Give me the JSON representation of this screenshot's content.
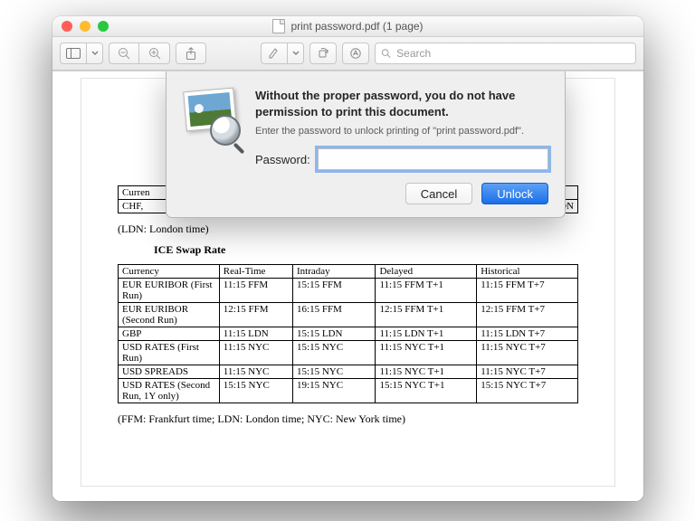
{
  "titlebar": {
    "title": "print password.pdf (1 page)"
  },
  "toolbar": {
    "search_placeholder": "Search"
  },
  "sheet": {
    "heading": "Without the proper password, you do not have permission to print this document.",
    "subtext": "Enter the password to unlock printing of \"print password.pdf\".",
    "password_label": "Password:",
    "password_value": "",
    "cancel_label": "Cancel",
    "unlock_label": "Unlock"
  },
  "document": {
    "fragment_table": {
      "row1": [
        "Curren",
        "",
        "",
        "",
        ""
      ],
      "row2": [
        "CHF,",
        "",
        "",
        "",
        "LDN"
      ]
    },
    "note1": "(LDN: London time)",
    "section_title": "ICE Swap Rate",
    "table": {
      "headers": [
        "Currency",
        "Real-Time",
        "Intraday",
        "Delayed",
        "Historical"
      ],
      "rows": [
        [
          "EUR EURIBOR (First Run)",
          "11:15 FFM",
          "15:15 FFM",
          "11:15 FFM T+1",
          "11:15 FFM T+7"
        ],
        [
          "EUR EURIBOR (Second Run)",
          "12:15 FFM",
          "16:15 FFM",
          "12:15 FFM T+1",
          "12:15 FFM T+7"
        ],
        [
          "GBP",
          "11:15 LDN",
          "15:15 LDN",
          "11:15 LDN T+1",
          "11:15 LDN T+7"
        ],
        [
          "USD RATES (First Run)",
          "11:15 NYC",
          "15:15 NYC",
          "11:15 NYC T+1",
          "11:15 NYC T+7"
        ],
        [
          "USD SPREADS",
          "11:15 NYC",
          "15:15 NYC",
          "11:15 NYC T+1",
          "11:15 NYC T+7"
        ],
        [
          "USD RATES (Second Run, 1Y only)",
          "15:15 NYC",
          "19:15 NYC",
          "15:15 NYC T+1",
          "15:15 NYC T+7"
        ]
      ]
    },
    "note2": "(FFM: Frankfurt time; LDN: London time; NYC: New York time)"
  }
}
